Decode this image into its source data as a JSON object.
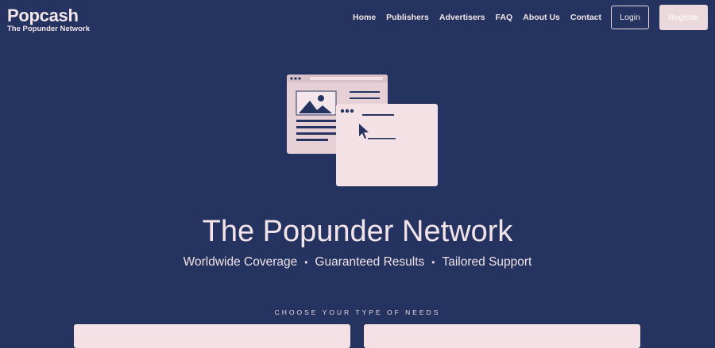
{
  "brand": {
    "name": "Popcash",
    "tagline": "The Popunder Network"
  },
  "nav": {
    "items": [
      {
        "label": "Home"
      },
      {
        "label": "Publishers"
      },
      {
        "label": "Advertisers"
      },
      {
        "label": "FAQ"
      },
      {
        "label": "About Us"
      },
      {
        "label": "Contact"
      }
    ],
    "login_label": "Login",
    "register_label": "Register"
  },
  "hero": {
    "title": "The Popunder Network",
    "features": [
      "Worldwide Coverage",
      "Guaranteed Results",
      "Tailored Support"
    ],
    "separator": "•",
    "illustration_icon": "popunder-windows-icon"
  },
  "needs": {
    "label": "CHOOSE YOUR TYPE OF NEEDS"
  },
  "colors": {
    "background": "#24335f",
    "accent": "#f1e1e6"
  }
}
